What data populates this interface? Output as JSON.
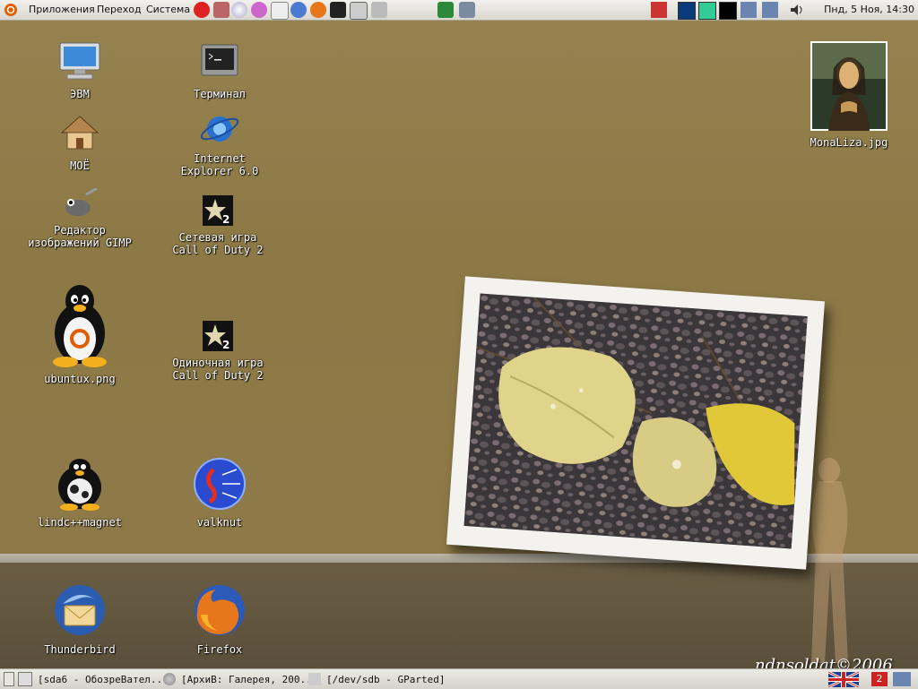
{
  "top_panel": {
    "menus": [
      "Приложения",
      "Переход",
      "Система"
    ],
    "clock": "Пнд,  5 Ноя, 14:30"
  },
  "desktop": {
    "icons": [
      {
        "label": "ЭВМ"
      },
      {
        "label": "Терминал"
      },
      {
        "label": "МОЁ"
      },
      {
        "label": "Internet\nExplorer 6.0"
      },
      {
        "label": "Редактор\nизображений GIMP"
      },
      {
        "label": "Сетевая игра\nCall of Duty 2"
      },
      {
        "label": "ubuntux.png"
      },
      {
        "label": "Одиночная игра\nCall of Duty 2"
      },
      {
        "label": "lindc++magnet"
      },
      {
        "label": "valknut"
      },
      {
        "label": "Thunderbird"
      },
      {
        "label": "Firefox"
      },
      {
        "label": "MonaLiza.jpg"
      }
    ],
    "watermark": "ndnsoldat©2006"
  },
  "taskbar": {
    "tasks": [
      "[sda6 - ОбозреВател...",
      "[АрхиВ: Галерея, 200...",
      "[/dev/sdb - GParted]"
    ]
  },
  "colors": {
    "panel": "#e6e4de",
    "wallpaper": "#8d7a47",
    "label_text": "#ffffff"
  }
}
